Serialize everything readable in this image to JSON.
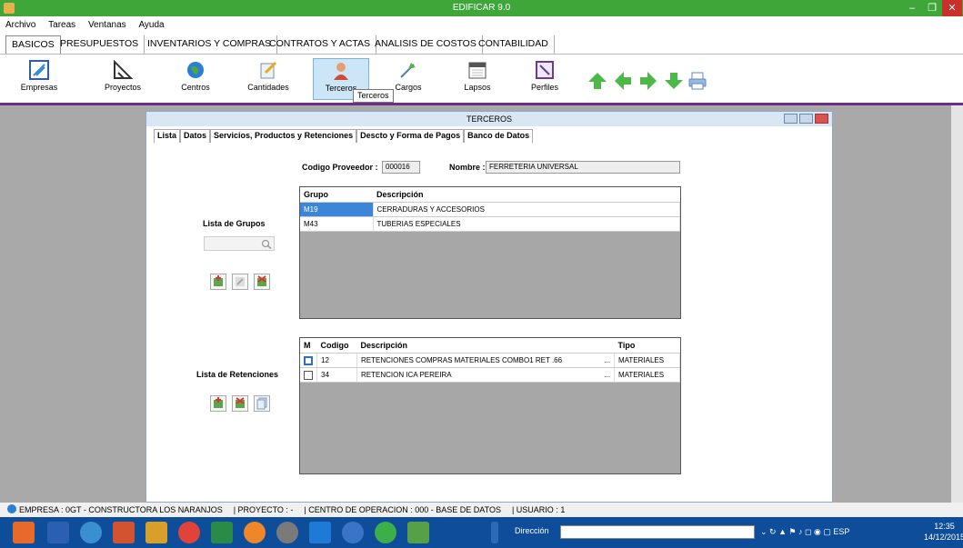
{
  "window": {
    "title": "EDIFICAR 9.0"
  },
  "menu": [
    "Archivo",
    "Tareas",
    "Ventanas",
    "Ayuda"
  ],
  "main_tabs": [
    "BASICOS",
    "PRESUPUESTOS",
    "INVENTARIOS Y COMPRAS",
    "CONTRATOS Y ACTAS",
    "ANALISIS DE COSTOS",
    "CONTABILIDAD"
  ],
  "ribbon": {
    "buttons": [
      "Empresas",
      "Proyectos",
      "Centros",
      "Cantidades",
      "Terceros",
      "Cargos",
      "Lapsos",
      "Perfiles"
    ],
    "tooltip": "Terceros"
  },
  "child_window": {
    "title": "TERCEROS",
    "tabs": [
      "Lista",
      "Datos",
      "Servicios, Productos y Retenciones",
      "Descto y Forma de Pagos",
      "Banco de Datos"
    ]
  },
  "proveedor": {
    "codigo_label": "Codigo Proveedor :",
    "codigo": "000016",
    "nombre_label": "Nombre :",
    "nombre": "FERRETERIA UNIVERSAL"
  },
  "grupos": {
    "label": "Lista de Grupos",
    "headers": [
      "Grupo",
      "Descripción"
    ],
    "rows": [
      {
        "grupo": "M19",
        "descripcion": "CERRADURAS Y ACCESORIOS"
      },
      {
        "grupo": "M43",
        "descripcion": "TUBERIAS ESPECIALES"
      }
    ]
  },
  "retenciones": {
    "label": "Lista de Retenciones",
    "headers": [
      "M",
      "Codigo",
      "Descripción",
      "Tipo"
    ],
    "rows": [
      {
        "codigo": "12",
        "descripcion": "RETENCIONES COMPRAS MATERIALES COMBO1 RET .66",
        "ellipsis": "...",
        "tipo": "MATERIALES"
      },
      {
        "codigo": "34",
        "descripcion": "RETENCION ICA PEREIRA",
        "ellipsis": "...",
        "tipo": "MATERIALES"
      }
    ]
  },
  "status": {
    "empresa": "EMPRESA : 0GT - CONSTRUCTORA LOS NARANJOS",
    "proyecto": "| PROYECTO : -",
    "centro": "| CENTRO DE OPERACION : 000 - BASE DE DATOS",
    "usuario": "| USUARIO : 1"
  },
  "taskbar": {
    "direccion_label": "Dirección",
    "lang": "ESP",
    "time": "12:35",
    "date": "14/12/2015"
  },
  "colors": {
    "titlebar": "#3fa63a",
    "accent_line": "#6b2c8a",
    "selection": "#3b86d8",
    "taskbar": "#0d4d99"
  }
}
